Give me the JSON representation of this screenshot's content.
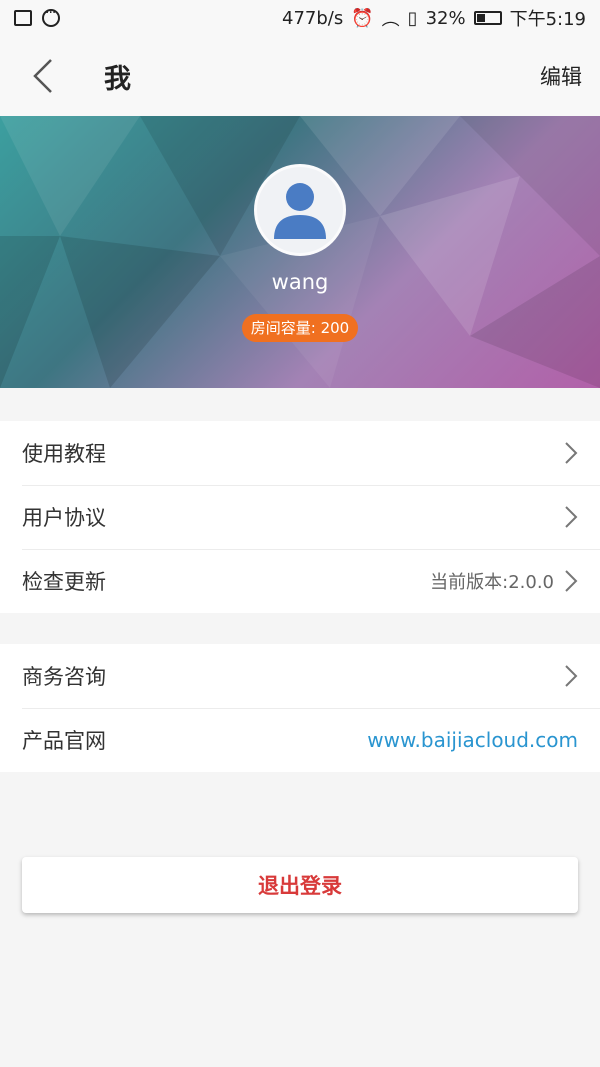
{
  "status_bar": {
    "speed": "477b/s",
    "battery": "32%",
    "time": "下午5:19"
  },
  "header": {
    "title": "我",
    "edit_label": "编辑"
  },
  "profile": {
    "username": "wang",
    "room_capacity": "房间容量: 200"
  },
  "menu_group_1": [
    {
      "label": "使用教程"
    },
    {
      "label": "用户协议"
    },
    {
      "label": "检查更新",
      "value": "当前版本:2.0.0"
    }
  ],
  "menu_group_2": [
    {
      "label": "商务咨询"
    },
    {
      "label": "产品官网",
      "link": "www.baijiacloud.com"
    }
  ],
  "logout_label": "退出登录",
  "colors": {
    "accent_orange": "#f07020",
    "link_blue": "#2a95d0",
    "logout_red": "#d83a3a"
  }
}
